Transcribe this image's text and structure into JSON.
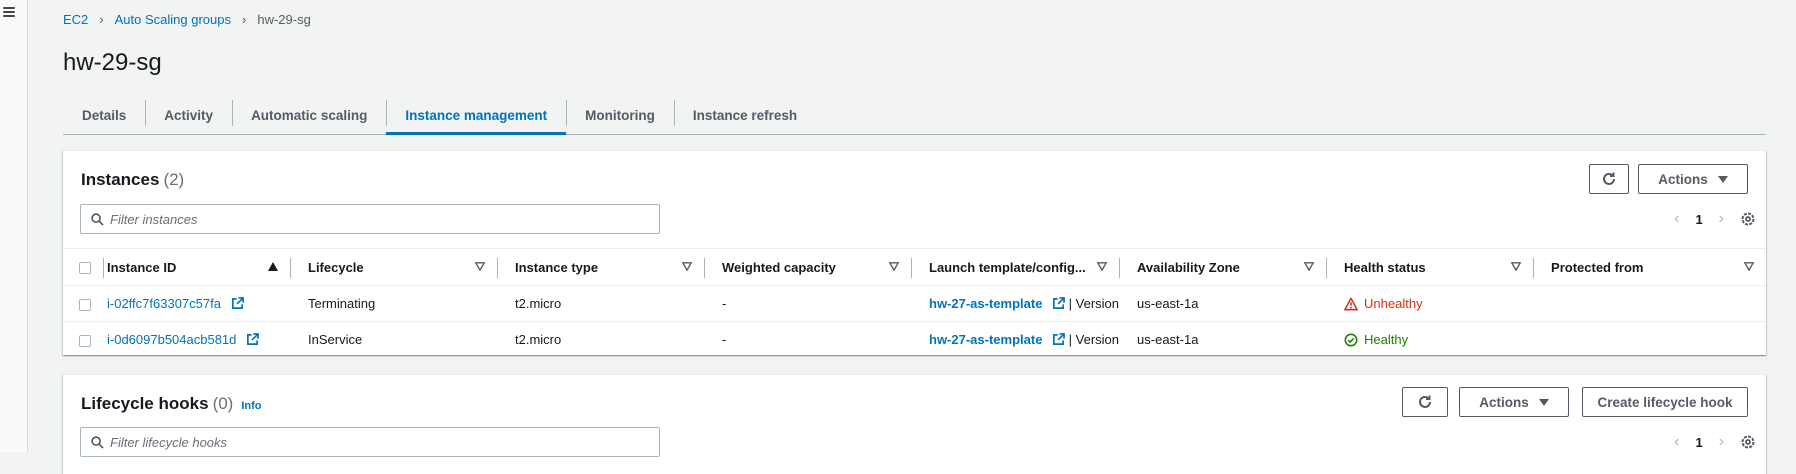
{
  "breadcrumb": {
    "root": "EC2",
    "parent": "Auto Scaling groups",
    "current": "hw-29-sg"
  },
  "page_title": "hw-29-sg",
  "tabs": [
    {
      "label": "Details",
      "active": false
    },
    {
      "label": "Activity",
      "active": false
    },
    {
      "label": "Automatic scaling",
      "active": false
    },
    {
      "label": "Instance management",
      "active": true
    },
    {
      "label": "Monitoring",
      "active": false
    },
    {
      "label": "Instance refresh",
      "active": false
    }
  ],
  "instances": {
    "title": "Instances",
    "count": "(2)",
    "actions_label": "Actions",
    "filter_placeholder": "Filter instances",
    "page": "1",
    "columns": [
      "Instance ID",
      "Lifecycle",
      "Instance type",
      "Weighted capacity",
      "Launch template/config...",
      "Availability Zone",
      "Health status",
      "Protected from"
    ],
    "rows": [
      {
        "instance_id": "i-02ffc7f63307c57fa",
        "lifecycle": "Terminating",
        "instance_type": "t2.micro",
        "weighted_capacity": "-",
        "launch_template": "hw-27-as-template",
        "version_text": "| Version",
        "az": "us-east-1a",
        "health": "Unhealthy",
        "health_state": "bad",
        "protected": ""
      },
      {
        "instance_id": "i-0d6097b504acb581d",
        "lifecycle": "InService",
        "instance_type": "t2.micro",
        "weighted_capacity": "-",
        "launch_template": "hw-27-as-template",
        "version_text": "| Version",
        "az": "us-east-1a",
        "health": "Healthy",
        "health_state": "good",
        "protected": ""
      }
    ]
  },
  "hooks": {
    "title": "Lifecycle hooks",
    "count": "(0)",
    "info_label": "Info",
    "actions_label": "Actions",
    "create_label": "Create lifecycle hook",
    "filter_placeholder": "Filter lifecycle hooks",
    "page": "1"
  },
  "colors": {
    "link": "#0073bb",
    "unhealthy": "#d13212",
    "healthy": "#1d8102"
  }
}
